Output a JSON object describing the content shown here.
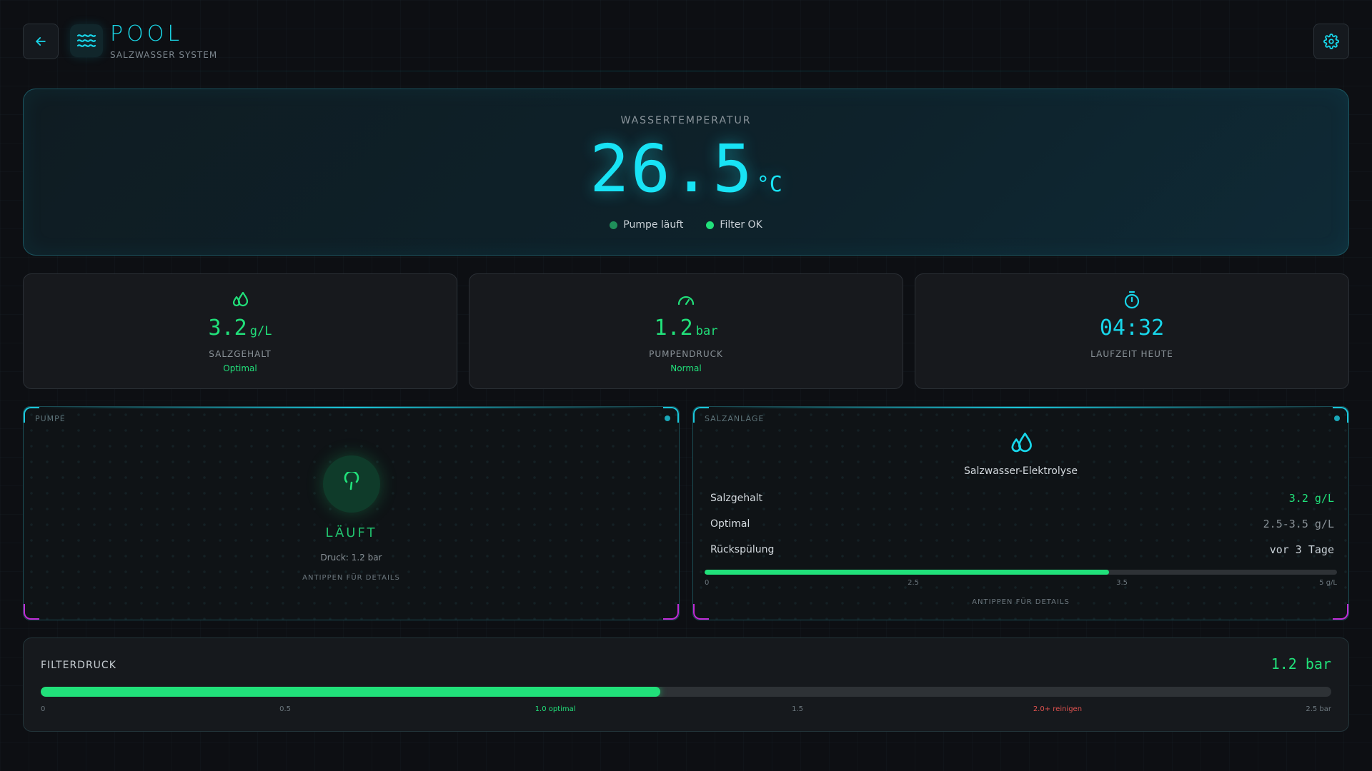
{
  "header": {
    "title": "POOL",
    "subtitle": "SALZWASSER SYSTEM"
  },
  "temperature": {
    "label": "WASSERTEMPERATUR",
    "value": "26.5",
    "unit": "°C",
    "status": [
      {
        "label": "Pumpe läuft",
        "color": "#1f8f5a"
      },
      {
        "label": "Filter OK",
        "color": "#21e07a"
      }
    ]
  },
  "stats": [
    {
      "icon": "salt-drops-icon",
      "value": "3.2",
      "unit": "g/L",
      "label": "SALZGEHALT",
      "sub": "Optimal",
      "color": "#21e07a"
    },
    {
      "icon": "gauge-icon",
      "value": "1.2",
      "unit": "bar",
      "label": "PUMPENDRUCK",
      "sub": "Normal",
      "color": "#21e07a"
    },
    {
      "icon": "stopwatch-icon",
      "value": "04:32",
      "unit": "",
      "label": "LAUFZEIT HEUTE",
      "sub": "",
      "color": "#18d6ea"
    }
  ],
  "pump_panel": {
    "tag": "PUMPE",
    "state": "LÄUFT",
    "pressure": "Druck: 1.2 bar",
    "hint": "ANTIPPEN FÜR DETAILS"
  },
  "salt_panel": {
    "tag": "SALZANLAGE",
    "title": "Salzwasser-Elektrolyse",
    "rows": [
      {
        "key": "Salzgehalt",
        "value": "3.2 g/L",
        "color": "#21e07a"
      },
      {
        "key": "Optimal",
        "value": "2.5-3.5 g/L",
        "color": "#8a9298"
      },
      {
        "key": "Rückspülung",
        "value": "vor 3 Tage",
        "color": "#c9d1d7"
      }
    ],
    "bar_fraction": 0.64,
    "ticks": [
      "0",
      "2.5",
      "3.5",
      "5 g/L"
    ],
    "hint": "ANTIPPEN FÜR DETAILS"
  },
  "filter": {
    "label": "FILTERDRUCK",
    "value": "1.2 bar",
    "bar_fraction": 0.48,
    "ticks": [
      {
        "label": "0",
        "color": "#6c777e"
      },
      {
        "label": "0.5",
        "color": "#6c777e"
      },
      {
        "label": "1.0 optimal",
        "color": "#21e07a"
      },
      {
        "label": "1.5",
        "color": "#6c777e"
      },
      {
        "label": "2.0+ reinigen",
        "color": "#e0524f"
      },
      {
        "label": "2.5 bar",
        "color": "#6c777e"
      }
    ]
  }
}
